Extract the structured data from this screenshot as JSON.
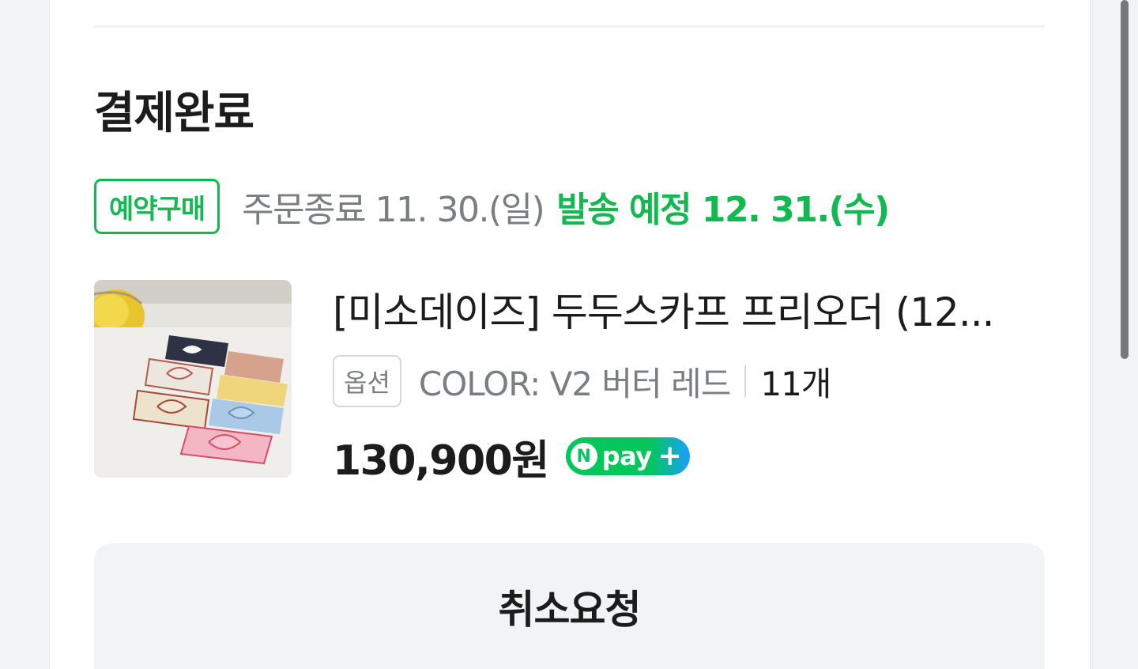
{
  "order": {
    "status_title": "결제완료",
    "preorder_badge": "예약구매",
    "order_end_text": "주문종료 11. 30.(일)",
    "ship_plan_text": "발송 예정 12. 31.(수)"
  },
  "product": {
    "name": "[미소데이즈] 두두스카프 프리오더 (12...",
    "option_label": "옵션",
    "option_value": "COLOR: V2 버터 레드",
    "quantity": "11개",
    "price": "130,900원",
    "pay_badge": {
      "n": "N",
      "text": "pay",
      "plus": "+"
    }
  },
  "actions": {
    "cancel_label": "취소요청"
  },
  "colors": {
    "accent_green": "#12b850",
    "npay_green": "#03c75a",
    "npay_blue": "#1a9fff",
    "text_dark": "#1c1c1c",
    "text_gray": "#7a7d82"
  }
}
